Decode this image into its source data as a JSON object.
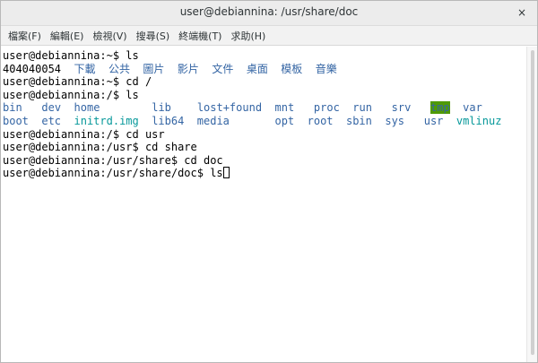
{
  "window": {
    "title": "user@debiannina: /usr/share/doc",
    "close_glyph": "×"
  },
  "menu": {
    "items": [
      "檔案(F)",
      "編輯(E)",
      "檢視(V)",
      "搜尋(S)",
      "終端機(T)",
      "求助(H)"
    ]
  },
  "terminal": {
    "l1_prompt": "user@debiannina:~$ ls",
    "l2_user": "404040054",
    "l2_dirs": [
      "下載",
      "公共",
      "圖片",
      "影片",
      "文件",
      "桌面",
      "模板",
      "音樂"
    ],
    "l3_prompt": "user@debiannina:~$ cd /",
    "l4_prompt": "user@debiannina:/$ ls",
    "row1": [
      "bin",
      "dev",
      "home",
      "lib",
      "lost+found",
      "mnt",
      "proc",
      "run",
      "srv",
      "tmp",
      "var"
    ],
    "row2": [
      "boot",
      "etc",
      "initrd.img",
      "lib64",
      "media",
      "opt",
      "root",
      "sbin",
      "sys",
      "usr",
      "vmlinuz"
    ],
    "l7_prompt": "user@debiannina:/$ cd usr",
    "l8_prompt": "user@debiannina:/usr$ cd share",
    "l9_prompt": "user@debiannina:/usr/share$ cd doc",
    "l10_prompt": "user@debiannina:/usr/share/doc$ ls",
    "colors": {
      "dir": "#3465a4",
      "link": "#06989a",
      "sticky_bg": "#4e9a06"
    }
  }
}
